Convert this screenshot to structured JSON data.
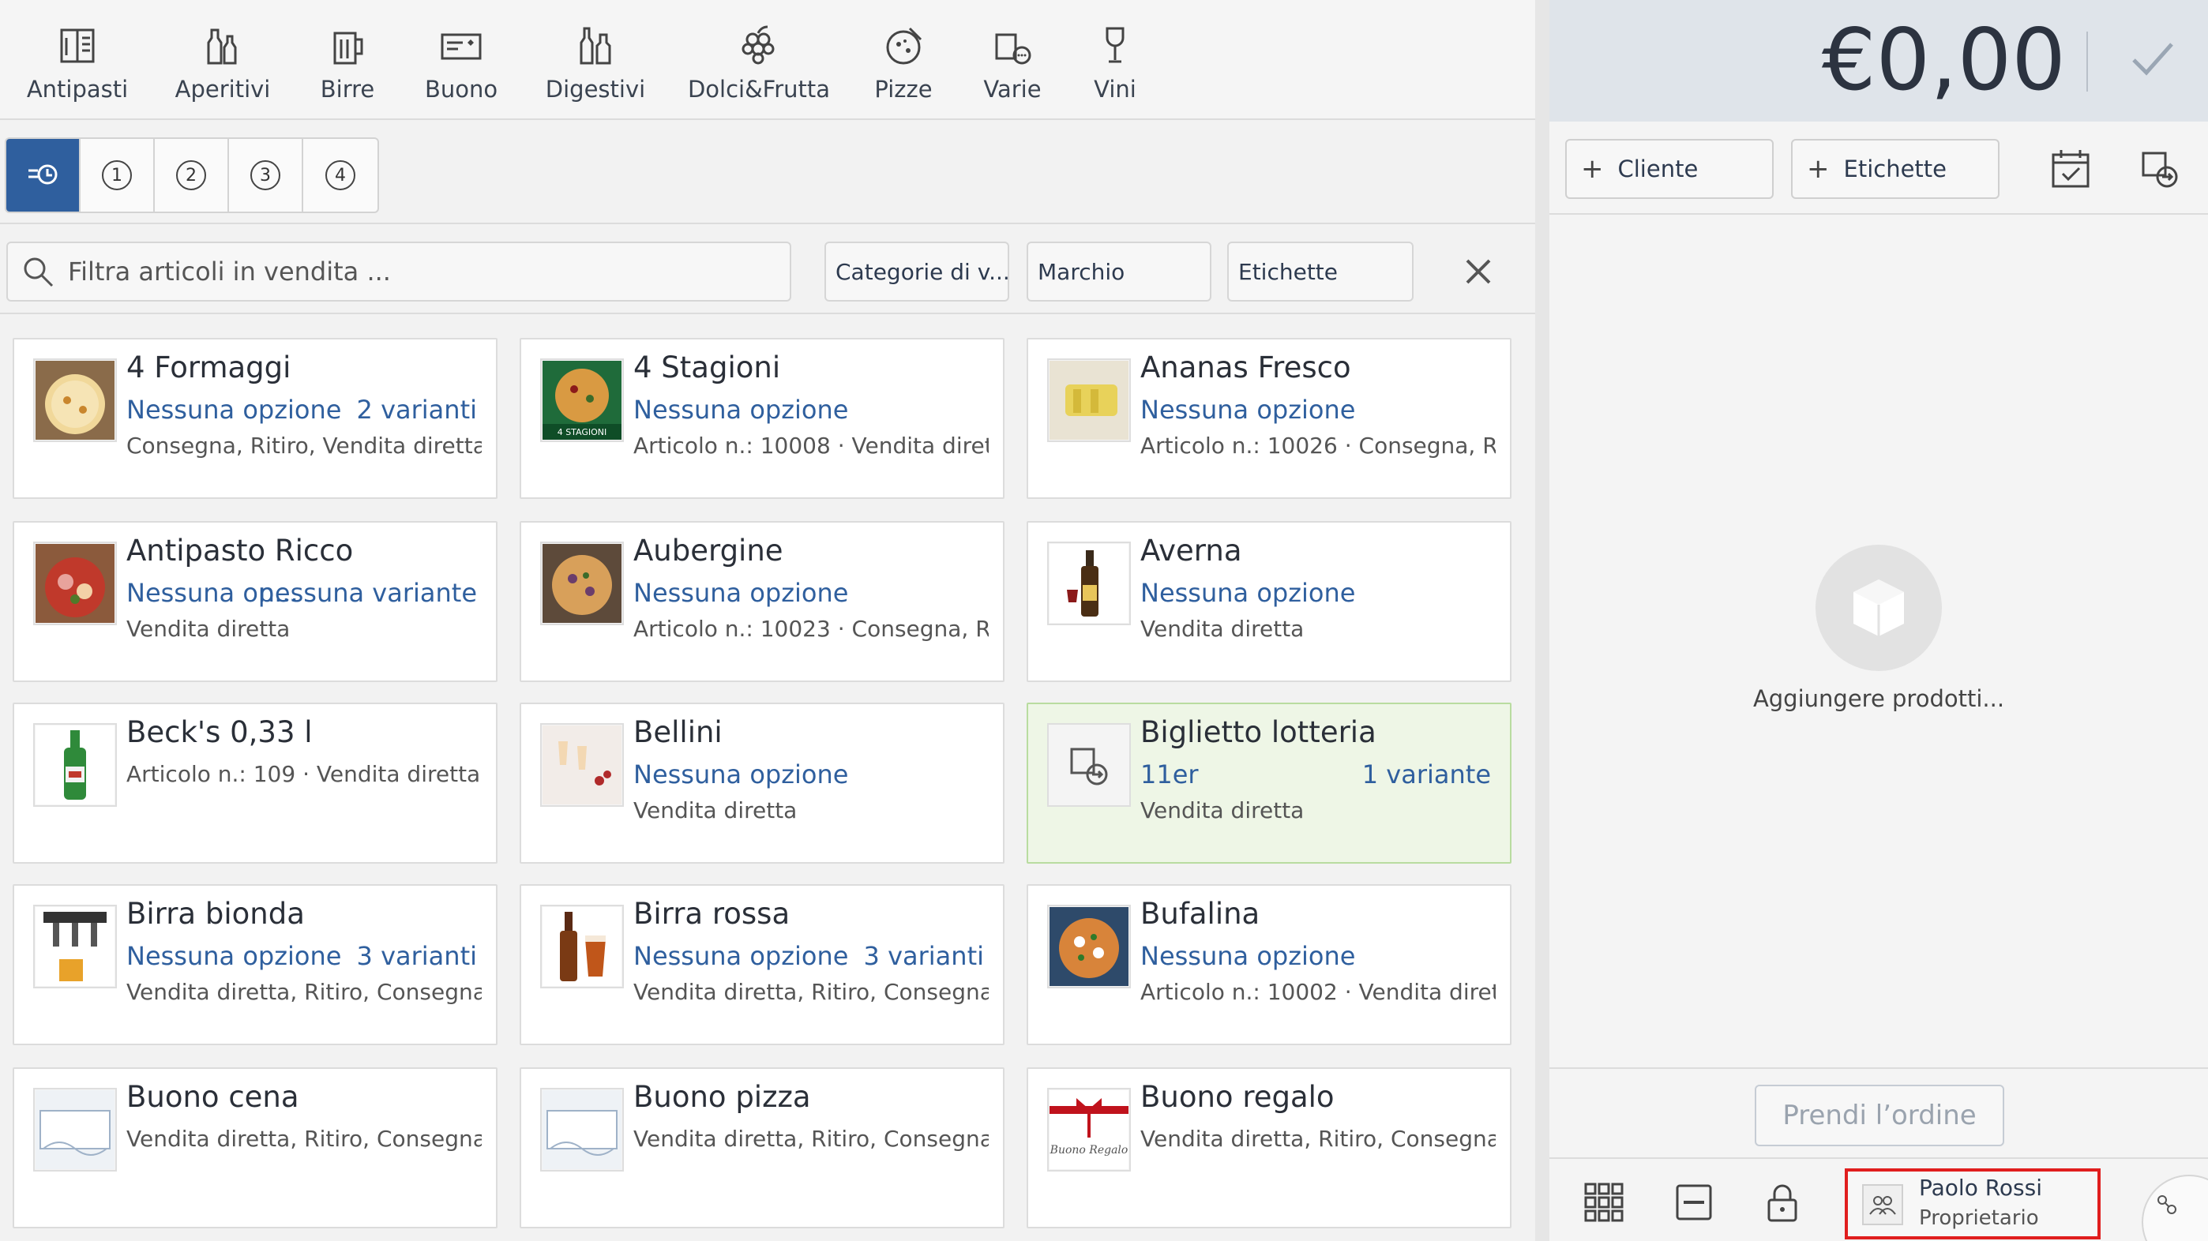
{
  "categories": [
    {
      "label": "Antipasti",
      "icon": "menu-card-icon"
    },
    {
      "label": "Aperitivi",
      "icon": "bottles-icon"
    },
    {
      "label": "Birre",
      "icon": "beer-mug-icon"
    },
    {
      "label": "Buono",
      "icon": "voucher-icon"
    },
    {
      "label": "Digestivi",
      "icon": "liquor-bottles-icon"
    },
    {
      "label": "Dolci&Frutta",
      "icon": "grapes-icon"
    },
    {
      "label": "Pizze",
      "icon": "pizza-icon"
    },
    {
      "label": "Varie",
      "icon": "misc-icon"
    },
    {
      "label": "Vini",
      "icon": "wine-glass-icon"
    }
  ],
  "tabs": [
    "1",
    "2",
    "3",
    "4"
  ],
  "filter": {
    "search_placeholder": "Filtra articoli in vendita ...",
    "categories_label": "Categorie di v...",
    "brand_label": "Marchio",
    "tags_label": "Etichette"
  },
  "products": [
    {
      "title": "4 Formaggi",
      "option": "Nessuna opzione",
      "variants": "2 varianti",
      "meta": "Consegna, Ritiro, Vendita diretta",
      "thumb": "pizza"
    },
    {
      "title": "4 Stagioni",
      "option": "Nessuna opzione",
      "variants": "",
      "meta": "Articolo n.: 10008 · Vendita dirett...",
      "thumb": "pizzabox"
    },
    {
      "title": "Ananas Fresco",
      "option": "Nessuna opzione",
      "variants": "",
      "meta": "Articolo n.: 10026 · Consegna, Rit...",
      "thumb": "pineapple"
    },
    {
      "title": "Antipasto Ricco",
      "option": "Nessuna op...",
      "variants": "nessuna variante",
      "meta": "Vendita diretta",
      "thumb": "antipasto"
    },
    {
      "title": "Aubergine",
      "option": "Nessuna opzione",
      "variants": "",
      "meta": "Articolo n.: 10023 · Consegna, Rit...",
      "thumb": "pizza2"
    },
    {
      "title": "Averna",
      "option": "Nessuna opzione",
      "variants": "",
      "meta": "Vendita diretta",
      "thumb": "liquor"
    },
    {
      "title": "Beck's 0,33 l",
      "option": "",
      "variants": "",
      "meta": "Articolo n.: 109 · Vendita diretta, ...",
      "thumb": "beerbottle"
    },
    {
      "title": "Bellini",
      "option": "Nessuna opzione",
      "variants": "",
      "meta": "Vendita diretta",
      "thumb": "glasses"
    },
    {
      "title": "Biglietto lotteria",
      "option": "11er",
      "variants": "1 variante",
      "meta": "Vendita diretta",
      "thumb": "ticket"
    },
    {
      "title": "Birra bionda",
      "option": "Nessuna opzione",
      "variants": "3 varianti",
      "meta": "Vendita diretta, Ritiro, Consegna",
      "thumb": "tap"
    },
    {
      "title": "Birra rossa",
      "option": "Nessuna opzione",
      "variants": "3 varianti",
      "meta": "Vendita diretta, Ritiro, Consegna",
      "thumb": "redbeer"
    },
    {
      "title": "Bufalina",
      "option": "Nessuna opzione",
      "variants": "",
      "meta": "Articolo n.: 10002 · Vendita dirett...",
      "thumb": "pizza3"
    },
    {
      "title": "Buono cena",
      "option": "",
      "variants": "",
      "meta": "Vendita diretta, Ritiro, Consegna",
      "thumb": "voucher"
    },
    {
      "title": "Buono pizza",
      "option": "",
      "variants": "",
      "meta": "Vendita diretta, Ritiro, Consegna",
      "thumb": "voucher"
    },
    {
      "title": "Buono regalo",
      "option": "",
      "variants": "",
      "meta": "Vendita diretta, Ritiro, Consegna",
      "thumb": "gift"
    }
  ],
  "cart": {
    "total": "€0,00",
    "customer_label": "Cliente",
    "tags_label": "Etichette",
    "empty_text": "Aggiungere prodotti...",
    "order_button": "Prendi l’ordine"
  },
  "user": {
    "name": "Paolo Rossi",
    "role": "Proprietario"
  },
  "colors": {
    "accent": "#2f5f9e",
    "highlight": "#eef6e6",
    "selection_border": "#e01e1e"
  }
}
